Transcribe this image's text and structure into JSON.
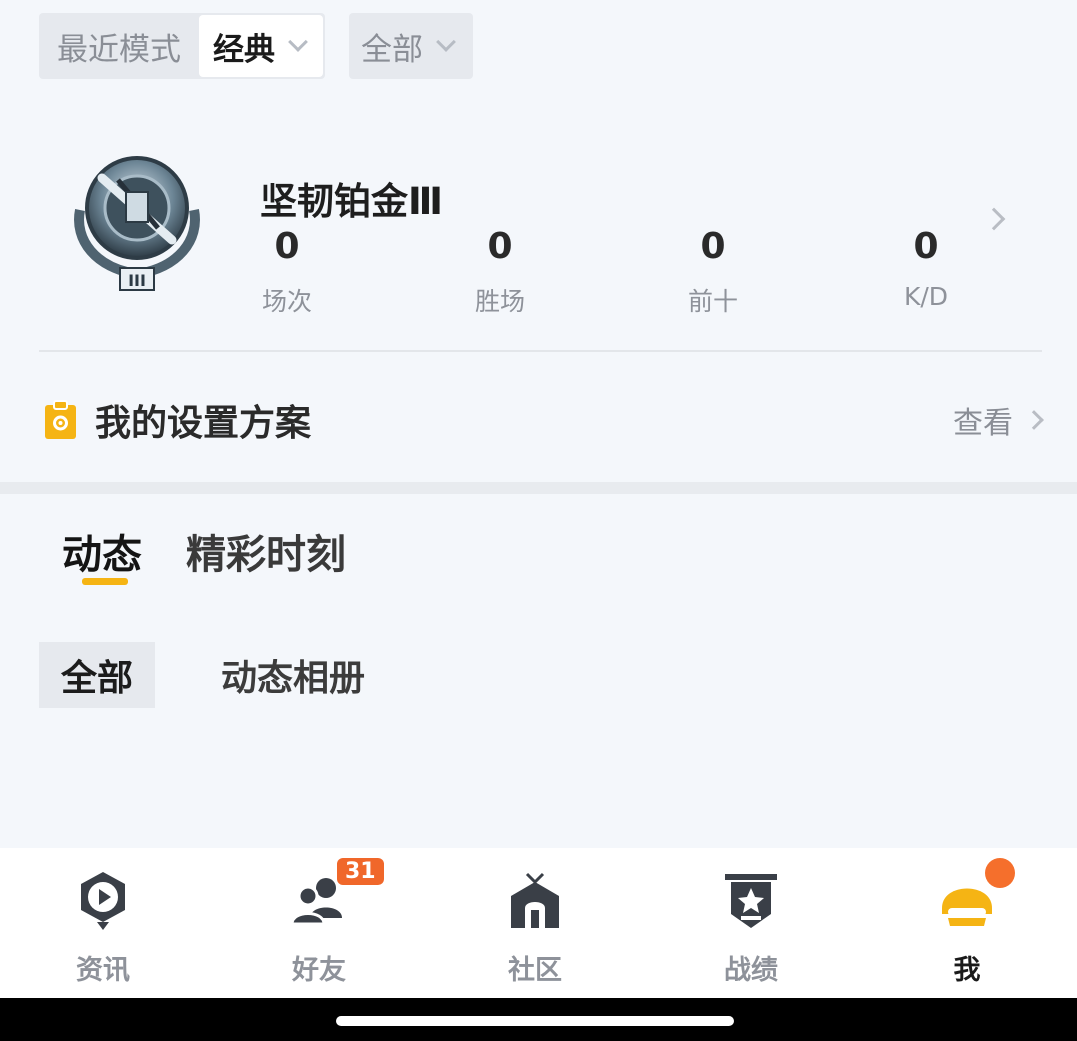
{
  "filters": {
    "mode_label": "最近模式",
    "mode_selected": "经典",
    "scope_selected": "全部"
  },
  "rank": {
    "name": "坚韧铂金Ⅲ",
    "emblem_numeral": "III"
  },
  "stats": [
    {
      "value": "0",
      "label": "场次"
    },
    {
      "value": "0",
      "label": "胜场"
    },
    {
      "value": "0",
      "label": "前十"
    },
    {
      "value": "0",
      "label": "K/D"
    }
  ],
  "settings_plan": {
    "title": "我的设置方案",
    "view_label": "查看"
  },
  "tabs": [
    {
      "label": "动态",
      "active": true
    },
    {
      "label": "精彩时刻",
      "active": false
    }
  ],
  "subtabs": [
    {
      "label": "全部",
      "active": true
    },
    {
      "label": "动态相册",
      "active": false
    }
  ],
  "nav": [
    {
      "label": "资讯",
      "icon": "news-play-icon"
    },
    {
      "label": "好友",
      "icon": "friends-icon",
      "badge": "31"
    },
    {
      "label": "社区",
      "icon": "community-house-icon"
    },
    {
      "label": "战绩",
      "icon": "record-star-shield-icon"
    },
    {
      "label": "我",
      "icon": "helmet-icon",
      "active": true
    }
  ],
  "colors": {
    "accent": "#f5b414",
    "badge": "#f0672a"
  }
}
